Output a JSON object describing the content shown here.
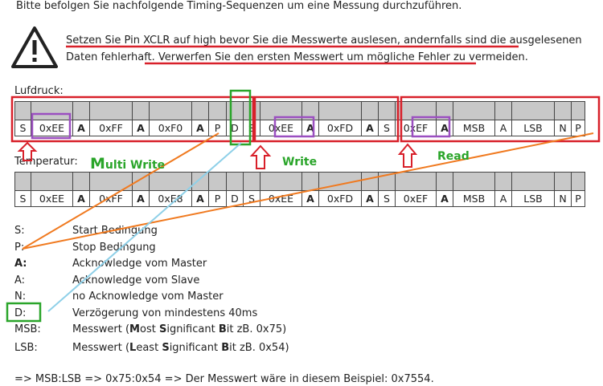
{
  "intro": "Bitte befolgen Sie nachfolgende Timing-Sequenzen um eine Messung durchzuführen.",
  "warning": {
    "icon": "warning-triangle-icon",
    "line1": "Setzen Sie Pin XCLR auf high bevor Sie die Messwerte auslesen, andernfalls sind die ausgelesenen",
    "line2a": "Daten fehlerhaft.",
    "line2b": "Verwerfen Sie den ersten Messwert um mögliche Fehler zu vermeiden."
  },
  "luftdruck_label": "Lufdruck:",
  "temperatur_label": "Temperatur:",
  "luftdruck_cells": [
    "S",
    "0xEE",
    "A",
    "0xFF",
    "A",
    "0xF0",
    "A",
    "P",
    "D",
    "S",
    "0xEE",
    "A",
    "0xFD",
    "A",
    "S",
    "0xEF",
    "A",
    "MSB",
    "A",
    "LSB",
    "N",
    "P"
  ],
  "temperatur_cells": [
    "S",
    "0xEE",
    "A",
    "0xFF",
    "A",
    "0xE8",
    "A",
    "P",
    "D",
    "S",
    "0xEE",
    "A",
    "0xFD",
    "A",
    "S",
    "0xEF",
    "A",
    "MSB",
    "A",
    "LSB",
    "N",
    "P"
  ],
  "bold_indices": [
    2,
    4,
    6,
    11,
    13,
    16
  ],
  "annotations": {
    "multi_write_m": "M",
    "multi_write_rest": "ulti Write",
    "write": "Write",
    "read": "Read"
  },
  "legend": [
    {
      "key": "S:",
      "value": "Start Bedingung"
    },
    {
      "key": "P:",
      "value": "Stop Bedingung"
    },
    {
      "key": "A:",
      "value": "Acknowledge vom Master",
      "bold": true
    },
    {
      "key": "A:",
      "value": "Acknowledge vom Slave"
    },
    {
      "key": "N:",
      "value": "no Acknowledge vom Master"
    },
    {
      "key": "D:",
      "value": "Verzögerung von mindestens 40ms"
    },
    {
      "key": "MSB:",
      "value_parts": [
        "Messwert (",
        "M",
        "ost ",
        "S",
        "ignificant ",
        "B",
        "it zB. 0x75)"
      ]
    },
    {
      "key": "LSB:",
      "value_parts": [
        "Messwert (",
        "L",
        "east ",
        "S",
        "ignificant ",
        "B",
        "it zB. 0x54)"
      ]
    }
  ],
  "footer": "=> MSB:LSB => 0x75:0x54 => Der Messwert wäre in diesem Beispiel: 0x7554.",
  "colors": {
    "red": "#d8202a",
    "green": "#2aa52a",
    "purple": "#9b4fc0",
    "orange": "#f07a20",
    "lightblue": "#8fd0e8",
    "header_gray": "#c8c8c8"
  }
}
